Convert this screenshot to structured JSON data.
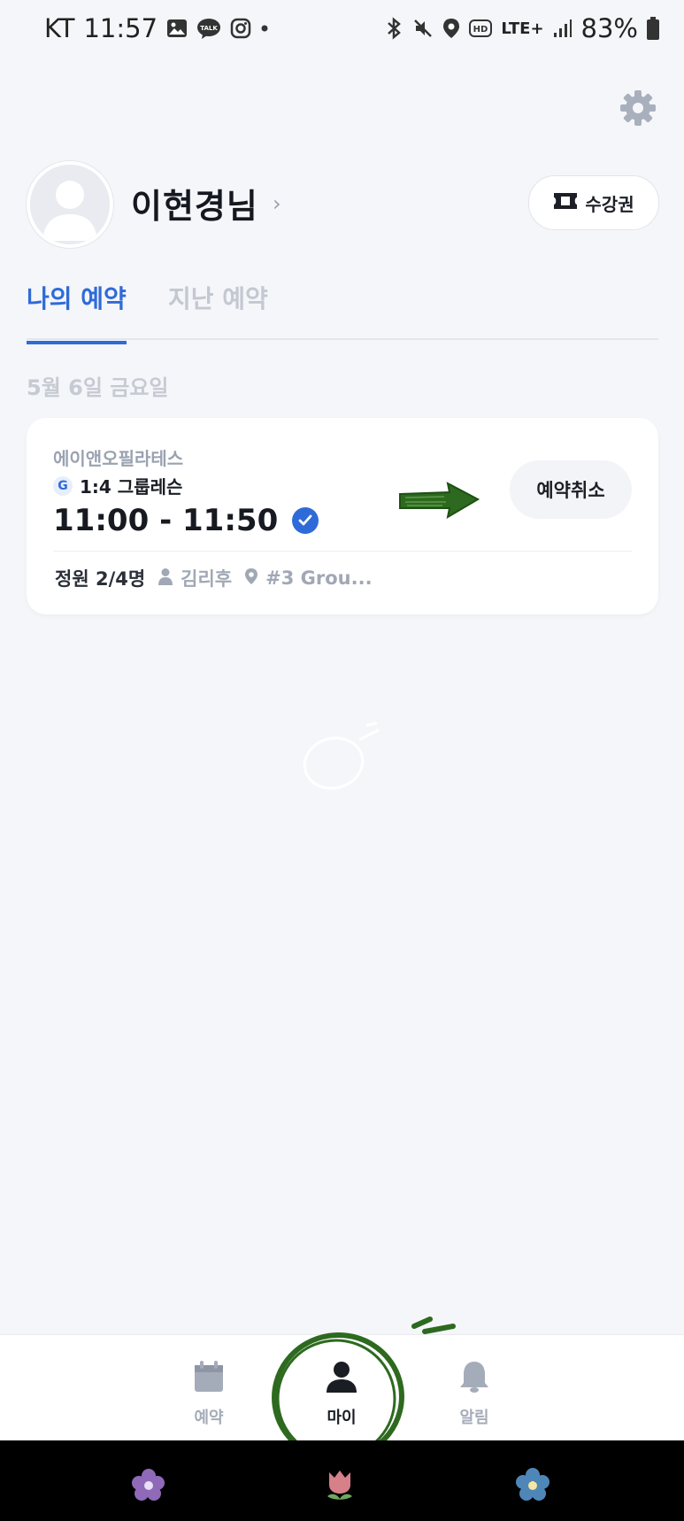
{
  "status_bar": {
    "carrier": "KT",
    "time": "11:57",
    "battery": "83%",
    "network": "LTE+"
  },
  "profile": {
    "name": "이현경님",
    "pass_button_label": "수강권"
  },
  "tabs": [
    {
      "label": "나의 예약",
      "active": true
    },
    {
      "label": "지난 예약",
      "active": false
    }
  ],
  "date_header": "5월 6일 금요일",
  "reservation": {
    "studio": "에이앤오필라테스",
    "badge": "G",
    "lesson": "1:4 그룹레슨",
    "time": "11:00 - 11:50",
    "cancel_label": "예약취소",
    "capacity_label": "정원 2/4명",
    "instructor": "김리후",
    "room": "#3 Grou..."
  },
  "bottom_nav": [
    {
      "label": "예약",
      "icon": "calendar-icon",
      "active": false
    },
    {
      "label": "마이",
      "icon": "person-icon",
      "active": true
    },
    {
      "label": "알림",
      "icon": "bell-icon",
      "active": false
    }
  ],
  "colors": {
    "accent": "#2f6bd8",
    "background": "#f5f6f9",
    "annotation_green": "#2d6a1f"
  }
}
